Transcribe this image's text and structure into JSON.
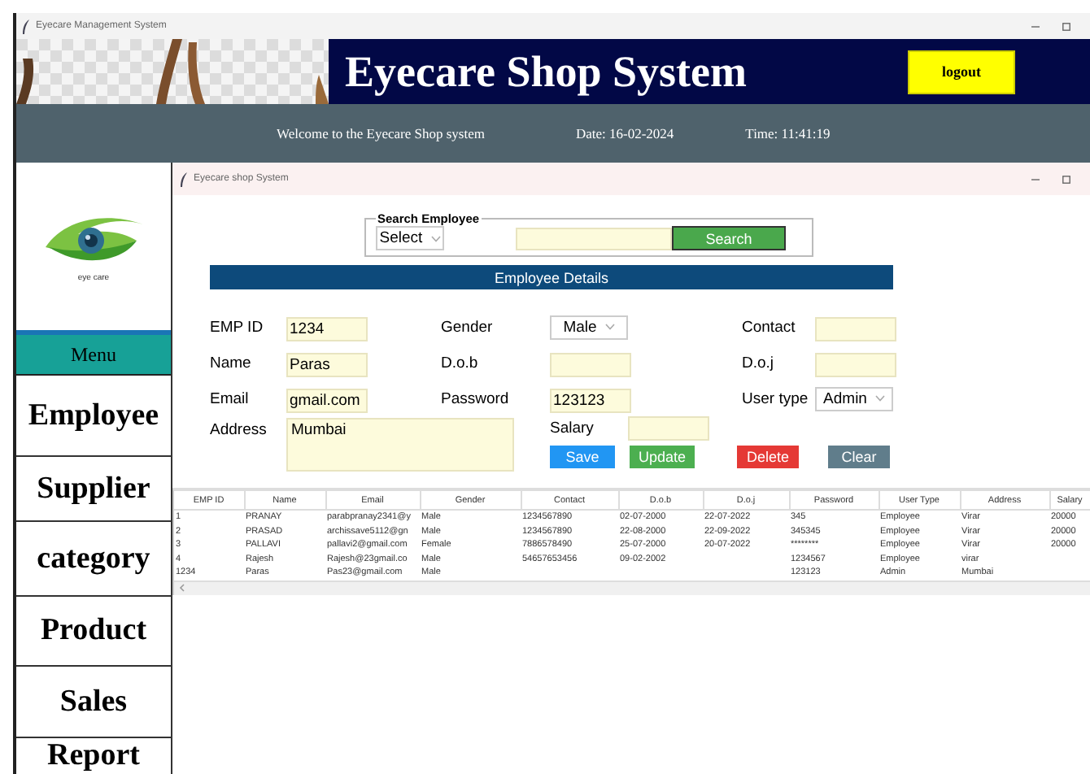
{
  "window": {
    "title": "Eyecare Management System"
  },
  "header": {
    "title": "Eyecare Shop System",
    "logout": "logout"
  },
  "info_bar": {
    "welcome": "Welcome to the Eyecare Shop system",
    "date": "Date: 16-02-2024",
    "time": "Time: 11:41:19"
  },
  "sidebar": {
    "logo_caption": "eye care",
    "menu_title": "Menu",
    "items": [
      {
        "label": "Employee"
      },
      {
        "label": "Supplier"
      },
      {
        "label": "category"
      },
      {
        "label": "Product"
      },
      {
        "label": "Sales"
      },
      {
        "label": "Report"
      }
    ]
  },
  "inner_window": {
    "title": "Eyecare shop System"
  },
  "search": {
    "group_label": "Search Employee",
    "field_combo": "Select",
    "button": "Search"
  },
  "details_title": "Employee Details",
  "form": {
    "rows": [
      [
        {
          "label": "EMP ID",
          "kind": "text",
          "value": "1234"
        },
        {
          "label": "Gender",
          "kind": "combo",
          "value": "Male"
        },
        {
          "label": "Contact",
          "kind": "text"
        }
      ],
      [
        {
          "label": "Name",
          "kind": "text",
          "value": "Paras"
        },
        {
          "label": "D.o.b",
          "kind": "text"
        },
        {
          "label": "D.o.j",
          "kind": "text"
        }
      ],
      [
        {
          "label": "Email",
          "kind": "text",
          "value": "gmail.com"
        },
        {
          "label": "Password",
          "kind": "text",
          "value": "123123"
        },
        {
          "label": "User type",
          "kind": "combo",
          "value": "Admin"
        }
      ]
    ],
    "address": {
      "label": "Address",
      "value": "Mumbai"
    },
    "salary": {
      "label": "Salary"
    },
    "buttons": [
      {
        "label": "Save",
        "kind": "save"
      },
      {
        "label": "Update",
        "kind": "update"
      },
      {
        "label": "Delete",
        "kind": "delete"
      },
      {
        "label": "Clear",
        "kind": "clear"
      }
    ]
  },
  "table": {
    "columns": [
      "EMP ID",
      "Name",
      "Email",
      "Gender",
      "Contact",
      "D.o.b",
      "D.o.j",
      "Password",
      "User Type",
      "Address",
      "Salary"
    ],
    "rows": [
      [
        "1",
        "PRANAY",
        "parabpranay2341@y",
        "Male",
        "1234567890",
        "02-07-2000",
        "22-07-2022",
        "345",
        "Employee",
        "Virar",
        "20000"
      ],
      [
        "2",
        "PRASAD",
        "archissave5112@gn",
        "Male",
        "1234567890",
        "22-08-2000",
        "22-09-2022",
        "345345",
        "Employee",
        "Virar",
        "20000"
      ],
      [
        "3",
        "PALLAVI",
        "pallavi2@gmail.com",
        "Female",
        "7886578490",
        "25-07-2000",
        "20-07-2022",
        "********",
        "Employee",
        "Virar",
        "20000"
      ],
      [
        "4",
        "Rajesh",
        "Rajesh@23gmail.co",
        "Male",
        "54657653456",
        "09-02-2002",
        null,
        "1234567",
        "Employee",
        "virar",
        null
      ],
      [
        "1234",
        "Paras",
        "Pas23@gmail.com",
        "Male",
        null,
        null,
        null,
        "123123",
        "Admin",
        "Mumbai",
        null
      ]
    ]
  }
}
